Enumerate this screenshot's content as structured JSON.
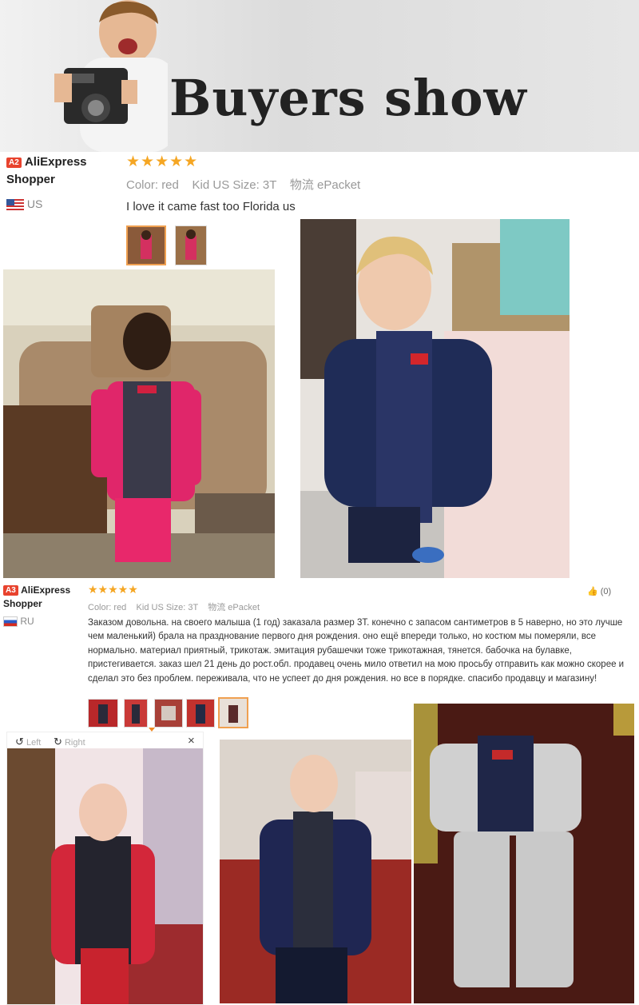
{
  "banner": {
    "title": "Buyers show"
  },
  "review1": {
    "badge": "A2",
    "shopper_line1": "AliExpress",
    "shopper_line2": "Shopper",
    "country": "US",
    "stars": "★★★★★",
    "color_label": "Color:",
    "color_value": "red",
    "size_label": "Kid US Size:",
    "size_value": "3T",
    "ship_label": "物流",
    "ship_value": "ePacket",
    "text": "I love it came fast too Florida us"
  },
  "review2": {
    "badge": "A3",
    "shopper_line1": "AliExpress",
    "shopper_line2": "Shopper",
    "country": "RU",
    "stars": "★★★★★",
    "color_label": "Color:",
    "color_value": "red",
    "size_label": "Kid US Size:",
    "size_value": "3T",
    "ship_label": "物流",
    "ship_value": "ePacket",
    "helpful_count": "(0)",
    "text": "Заказом довольна. на своего малыша (1 год) заказала размер 3Т. конечно с запасом сантиметров в 5 наверно, но это лучше чем маленький) брала на празднование первого дня рождения. оно ещё впереди только, но костюм мы померяли, все нормально. материал приятный, трикотаж. эмитация рубашечки тоже трикотажная, тянется. бабочка на булавке, пристегивается. заказ шел 21 день до рост.обл. продавец очень мило ответил на мою просьбу отправить как можно скорее и сделал это без проблем. переживала, что не успеет до дня рождения. но все в порядке. спасибо продавцу и магазину!"
  },
  "viewer": {
    "left_label": "Left",
    "right_label": "Right",
    "close": "×"
  },
  "icons": [
    "camera-icon",
    "thumbs-up-icon",
    "rotate-left-icon",
    "rotate-right-icon",
    "close-icon"
  ]
}
